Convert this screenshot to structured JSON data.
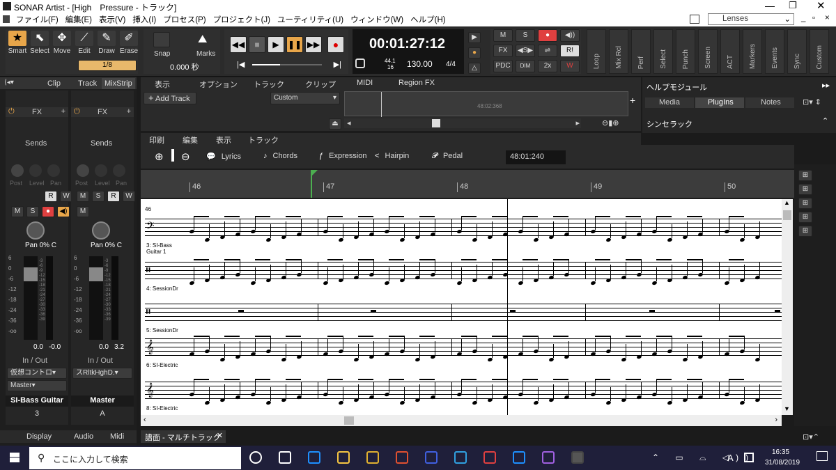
{
  "window": {
    "title": "SONAR Artist - [High　Pressure - トラック]"
  },
  "menu": [
    "ファイル(F)",
    "編集(E)",
    "表示(V)",
    "挿入(I)",
    "プロセス(P)",
    "プロジェクト(J)",
    "ユーティリティ(U)",
    "ウィンドウ(W)",
    "ヘルプ(H)"
  ],
  "lenses": "Lenses",
  "tools": [
    "Smart",
    "Select",
    "Move",
    "Edit",
    "Draw",
    "Erase"
  ],
  "snap": {
    "label": "Snap",
    "value": "1/8",
    "markers": "Marks",
    "time": "0.000 秒"
  },
  "transport": {
    "time": "00:01:27:12",
    "rate_top": "44.1",
    "rate_bottom": "16",
    "tempo": "130.00",
    "meter": "4/4"
  },
  "mix_buttons": [
    "M",
    "S",
    "FX",
    "PDC",
    "DIM",
    "2x",
    "R!"
  ],
  "vtabs": [
    "Loop",
    "Mix Rcl",
    "Perf",
    "Select",
    "Punch",
    "Screen",
    "ACT",
    "Markers",
    "Events",
    "Sync",
    "Custom"
  ],
  "inspector": {
    "tabs": [
      "Clip",
      "Track",
      "MixStrip"
    ],
    "fx": "FX",
    "sends": "Sends",
    "post": "Post",
    "level": "Level",
    "pan_label": "Pan",
    "pan1": "Pan 0% C",
    "pan2": "Pan 0% C",
    "val1a": "0.0",
    "val1b": "-0.0",
    "val2a": "0.0",
    "val2b": "3.2",
    "inout": "In / Out",
    "in1": "仮想コントロ",
    "in2": "スRltkHghD.",
    "out1": "Master",
    "track1": "SI-Bass Guitar",
    "track2": "Master",
    "num1": "3",
    "num2": "A",
    "bottom_tabs": [
      "Display",
      "Audio",
      "Midi"
    ],
    "db": [
      "6",
      "0",
      "-6",
      "-12",
      "-18",
      "-24",
      "-36",
      "-oo"
    ],
    "meter_scale": [
      "-3",
      "-6",
      "-9",
      "-12",
      "-15",
      "-18",
      "-21",
      "-24",
      "-27",
      "-30",
      "-33",
      "-36",
      "-39"
    ]
  },
  "trackview": {
    "menus": [
      "表示",
      "オプション",
      "トラック",
      "クリップ",
      "MIDI",
      "Region FX"
    ],
    "add_track": "Add Track",
    "custom": "Custom",
    "ruler_mark": "48:02:368"
  },
  "staffview": {
    "menus": [
      "印刷",
      "編集",
      "表示",
      "トラック"
    ],
    "tools": [
      "Lyrics",
      "Chords",
      "Expression",
      "Hairpin",
      "Pedal"
    ],
    "position": "48:01:240",
    "measures": [
      "46",
      "47",
      "48",
      "49",
      "50"
    ],
    "first_measure": "46",
    "tracks": [
      "3: SI-Bass Guitar 1",
      "4: SessionDr",
      "5: SessionDr",
      "6: SI-Electric",
      "8: SI-Electric"
    ]
  },
  "browser": {
    "title": "ヘルプモジュール",
    "tabs": [
      "Media",
      "PlugIns",
      "Notes"
    ],
    "synth": "シンセラック"
  },
  "tab_bottom": "譜面 - マルチトラック",
  "taskbar": {
    "search": "ここに入力して検索",
    "time": "16:35",
    "date": "31/08/2019",
    "lang": "A"
  }
}
